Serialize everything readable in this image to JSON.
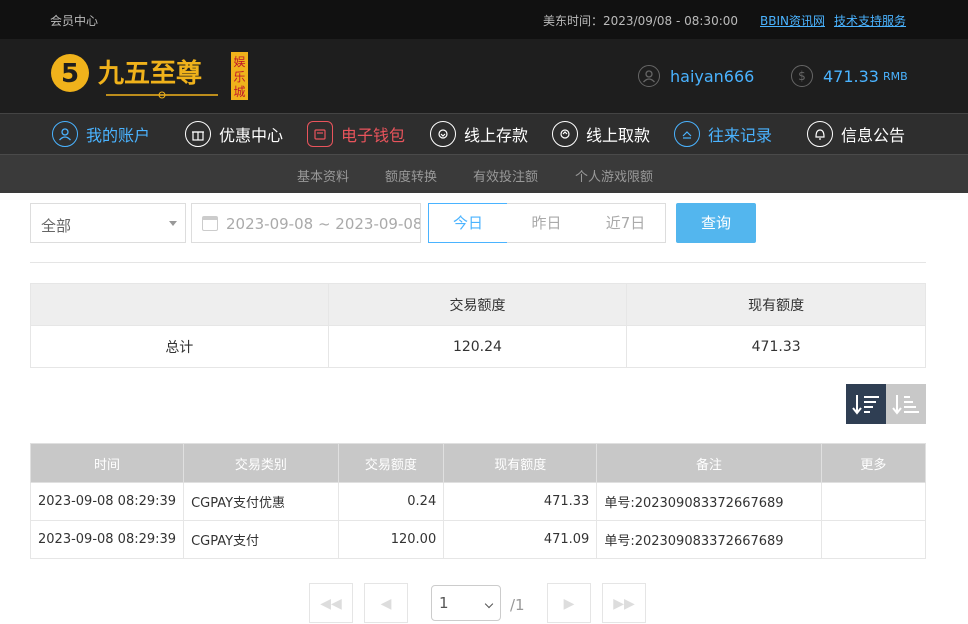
{
  "topbar": {
    "member_center": "会员中心",
    "time_text": "美东时间：2023/09/08 - 08:30:00",
    "link_bbin": "BBIN资讯网",
    "link_support": "技术支持服务"
  },
  "header": {
    "logo_text": "九五至尊",
    "logo_badge": "娱乐城",
    "username": "haiyan666",
    "balance": "471.33",
    "currency": "RMB"
  },
  "nav": {
    "items": [
      {
        "label": "我的账户",
        "icon": "user-icon"
      },
      {
        "label": "优惠中心",
        "icon": "gift-icon"
      },
      {
        "label": "电子钱包",
        "icon": "wallet-icon"
      },
      {
        "label": "线上存款",
        "icon": "deposit-icon"
      },
      {
        "label": "线上取款",
        "icon": "withdraw-icon"
      },
      {
        "label": "往来记录",
        "icon": "records-icon"
      },
      {
        "label": "信息公告",
        "icon": "bell-icon"
      }
    ]
  },
  "subnav": {
    "items": [
      "基本资料",
      "额度转换",
      "有效投注额",
      "个人游戏限额"
    ]
  },
  "filter": {
    "type_value": "全部",
    "date_range": "2023-09-08 ~ 2023-09-08",
    "btn_today": "今日",
    "btn_yesterday": "昨日",
    "btn_7days": "近7日",
    "btn_query": "查询"
  },
  "summary": {
    "headers": [
      "",
      "交易额度",
      "现有额度"
    ],
    "row": [
      "总计",
      "120.24",
      "471.33"
    ]
  },
  "records": {
    "headers": [
      "时间",
      "交易类别",
      "交易额度",
      "现有额度",
      "备注",
      "更多"
    ],
    "rows": [
      [
        "2023-09-08 08:29:39",
        "CGPAY支付优惠",
        "0.24",
        "471.33",
        "单号:202309083372667689",
        ""
      ],
      [
        "2023-09-08 08:29:39",
        "CGPAY支付",
        "120.00",
        "471.09",
        "单号:202309083372667689",
        ""
      ]
    ]
  },
  "pager": {
    "page_value": "1",
    "total": "/1"
  },
  "colors": {
    "accent": "#4ab3ff",
    "wallet_active": "#e9545c",
    "query_button": "#53b6ee",
    "logo_gold": "#f0b21b"
  }
}
